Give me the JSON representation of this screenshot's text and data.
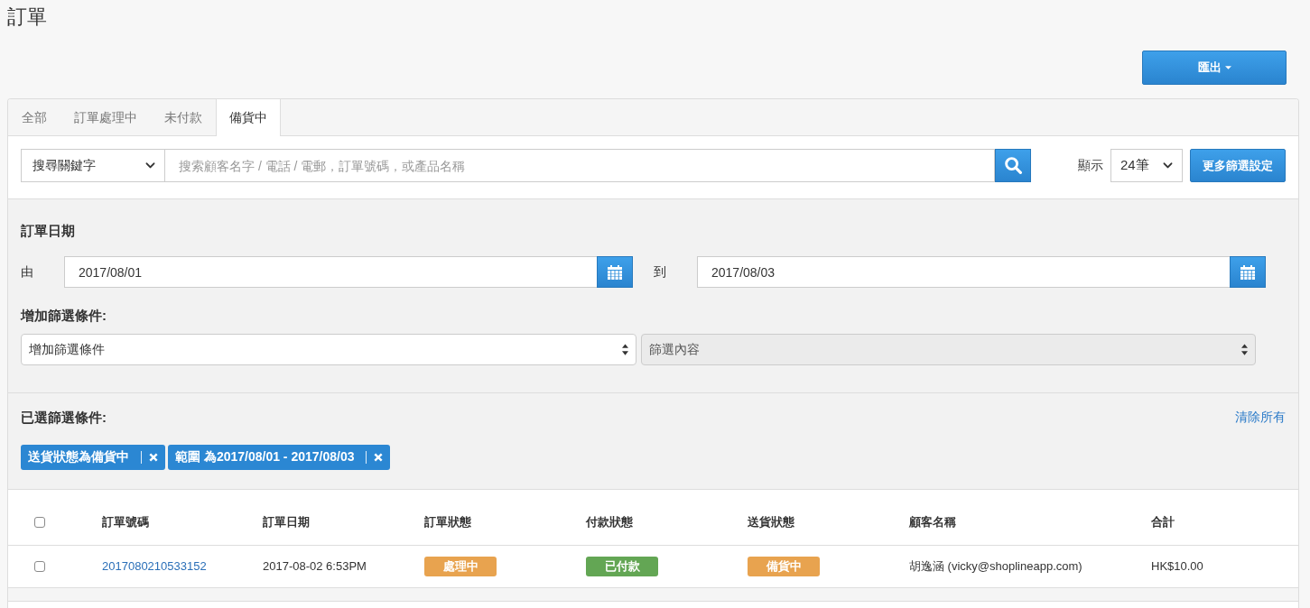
{
  "page": {
    "title": "訂單"
  },
  "export_button": {
    "label": "匯出"
  },
  "tabs": [
    {
      "label": "全部",
      "selected": false
    },
    {
      "label": "訂單處理中",
      "selected": false
    },
    {
      "label": "未付款",
      "selected": false
    },
    {
      "label": "備貨中",
      "selected": true
    }
  ],
  "search": {
    "scope": "搜尋關鍵字",
    "placeholder": "搜索顧客名字 / 電話 / 電郵，訂單號碼，或產品名稱"
  },
  "page_size": {
    "label": "顯示",
    "value": "24筆"
  },
  "more_filters_button": {
    "label": "更多篩選設定"
  },
  "date_filter": {
    "title": "訂單日期",
    "from": {
      "label": "由",
      "value": "2017/08/01"
    },
    "to": {
      "label": "到",
      "value": "2017/08/03"
    }
  },
  "add_filter": {
    "title": "增加篩選條件:",
    "condition": {
      "value": "增加篩選條件",
      "disabled": false
    },
    "content": {
      "value": "篩選內容",
      "disabled": true
    }
  },
  "selected_filters": {
    "title": "已選篩選條件:",
    "clear_all": "清除所有",
    "chips": [
      {
        "label": "送貨狀態為備貨中"
      },
      {
        "label": "範圍 為2017/08/01 - 2017/08/03"
      }
    ]
  },
  "table": {
    "select_all": {
      "checked": false
    },
    "columns": [
      "訂單號碼",
      "訂單日期",
      "訂單狀態",
      "付款狀態",
      "送貨狀態",
      "顧客名稱",
      "合計"
    ],
    "rows": [
      {
        "checked": false,
        "order_number": "2017080210533152",
        "date": "2017-08-02 6:53PM",
        "order_status": {
          "label": "處理中",
          "color": "#e8a34f"
        },
        "payment_status": {
          "label": "已付款",
          "color": "#63a654"
        },
        "shipping_status": {
          "label": "備貨中",
          "color": "#e8a34f"
        },
        "customer": "胡逸涵 (vicky@shoplineapp.com)",
        "total": "HK$10.00"
      }
    ]
  }
}
